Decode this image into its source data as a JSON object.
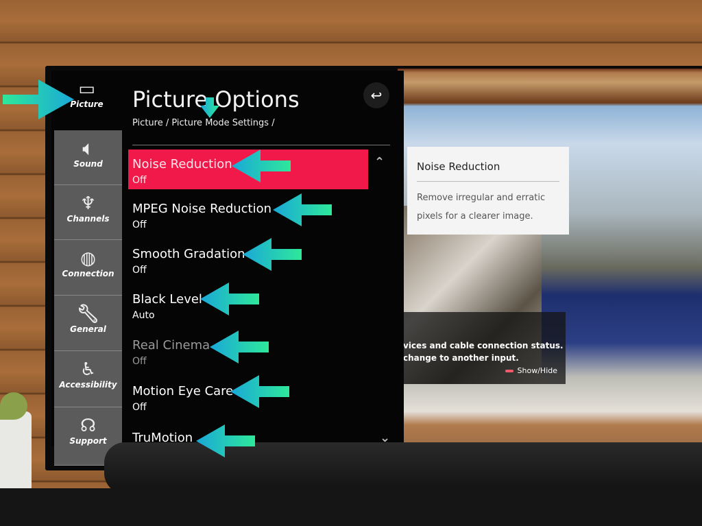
{
  "header": {
    "title": "Picture Options",
    "breadcrumb": "Picture / Picture Mode Settings /",
    "back_icon": "back-arrow-icon"
  },
  "sidebar": {
    "items": [
      {
        "label": "Picture",
        "icon": "picture-icon",
        "selected": true
      },
      {
        "label": "Sound",
        "icon": "speaker-icon"
      },
      {
        "label": "Channels",
        "icon": "satellite-icon"
      },
      {
        "label": "Connection",
        "icon": "globe-icon"
      },
      {
        "label": "General",
        "icon": "wrench-icon"
      },
      {
        "label": "Accessibility",
        "icon": "accessibility-icon"
      },
      {
        "label": "Support",
        "icon": "headset-icon"
      }
    ]
  },
  "options": [
    {
      "name": "Noise Reduction",
      "value": "Off",
      "selected": true
    },
    {
      "name": "MPEG Noise Reduction",
      "value": "Off"
    },
    {
      "name": "Smooth Gradation",
      "value": "Off"
    },
    {
      "name": "Black Level",
      "value": "Auto"
    },
    {
      "name": "Real Cinema",
      "value": "Off",
      "disabled": true
    },
    {
      "name": "Motion Eye Care",
      "value": "Off"
    },
    {
      "name": "TruMotion",
      "value": ""
    }
  ],
  "tooltip": {
    "title": "Noise Reduction",
    "description": "Remove irregular and erratic pixels for a clearer image."
  },
  "info_overlay": {
    "line1": "vices and cable connection status.",
    "line2": "change to another input.",
    "show_hide": "Show/Hide"
  },
  "colors": {
    "highlight": "#f0194a",
    "sidebar": "#5b5b5b",
    "arrow_start": "#1aa8d8",
    "arrow_end": "#2ee89a"
  }
}
